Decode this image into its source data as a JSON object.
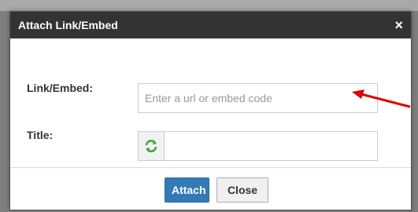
{
  "dialog": {
    "title": "Attach Link/Embed",
    "close_symbol": "×"
  },
  "form": {
    "link_label": "Link/Embed:",
    "link_placeholder": "Enter a url or embed code",
    "link_value": "",
    "title_label": "Title:",
    "title_value": "",
    "refresh_icon": "refresh-icon"
  },
  "footer": {
    "attach_label": "Attach",
    "close_label": "Close"
  },
  "colors": {
    "titlebar": "#333333",
    "attach_button": "#337ab7",
    "annotation_arrow": "#e00000",
    "refresh_icon": "#3aa63a"
  }
}
